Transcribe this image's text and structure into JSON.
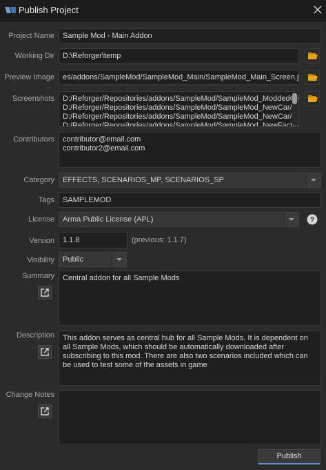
{
  "window": {
    "title": "Publish Project",
    "logo_icon": "reforger-logo-icon",
    "close_icon": "close-icon"
  },
  "labels": {
    "project_name": "Project Name",
    "working_dir": "Working Dir",
    "preview_image": "Preview Image",
    "screenshots": "Screenshots",
    "contributors": "Contributors",
    "category": "Category",
    "tags": "Tags",
    "license": "License",
    "version": "Version",
    "visibility": "Visibility",
    "summary": "Summary",
    "description": "Description",
    "change_notes": "Change Notes"
  },
  "fields": {
    "project_name": "Sample Mod - Main Addon",
    "working_dir": "D:\\Reforger\\temp",
    "preview_image": "es/addons/SampleMod/SampleMod_Main/SampleMod_Main_Screen.jpg",
    "screenshots": [
      "D:/Reforger/Repositories/addons/SampleMod/SampleMod_ModdedCa",
      "D:/Reforger/Repositories/addons/SampleMod/SampleMod_NewCar/L",
      "D:/Reforger/Repositories/addons/SampleMod/SampleMod_NewCar/L",
      "D:/Reforger/Repositories/addons/SampleMod/SampleMod_NewFactio"
    ],
    "contributors": [
      "contributor@email.com",
      "contributor2@email.com"
    ],
    "category": "EFFECTS, SCENARIOS_MP, SCENARIOS_SP",
    "tags": "SAMPLEMOD",
    "license": "Arma Public License (APL)",
    "version": "1.1.8",
    "previous_version": "(previous: 1.1.7)",
    "visibility": "Public",
    "summary": "Central addon for all Sample Mods",
    "description": "This addon serves as central hub for all Sample Mods. It is dependent on all Sample Mods, which should be automatically downloaded after subscribing to this mod. There are also two scenarios included which can be used to test some of the assets in game",
    "change_notes": ""
  },
  "buttons": {
    "publish": "Publish"
  },
  "colors": {
    "accent": "#5b8fc9",
    "folder": "#e8a21e",
    "background": "#2b2b2b",
    "field": "#1f1f1f"
  }
}
